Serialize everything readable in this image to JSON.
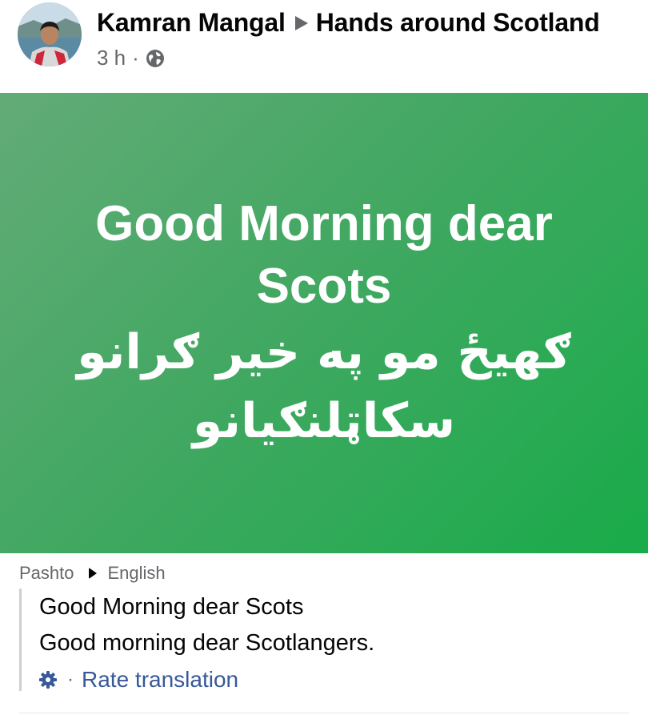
{
  "post": {
    "author": "Kamran Mangal",
    "group": "Hands around Scotland",
    "time": "3 h",
    "separator": "·",
    "audience_icon": "globe-icon"
  },
  "banner": {
    "line1": "Good Morning dear",
    "line2": "Scots",
    "line3": "ګهيځ مو په خير ګرانو",
    "line4": "سکاټلنګيانو",
    "colors": {
      "start": "#63ab78",
      "end": "#19ab4a",
      "text": "#ffffff"
    }
  },
  "translation": {
    "source_language": "Pashto",
    "target_language": "English",
    "line1": "Good Morning dear Scots",
    "line2": "Good morning dear Scotlangers.",
    "separator": "·",
    "rate_label": "Rate translation",
    "settings_icon": "gear-icon"
  },
  "colors": {
    "link": "#385898",
    "secondary_text": "#65676b",
    "primary_text": "#050505"
  }
}
